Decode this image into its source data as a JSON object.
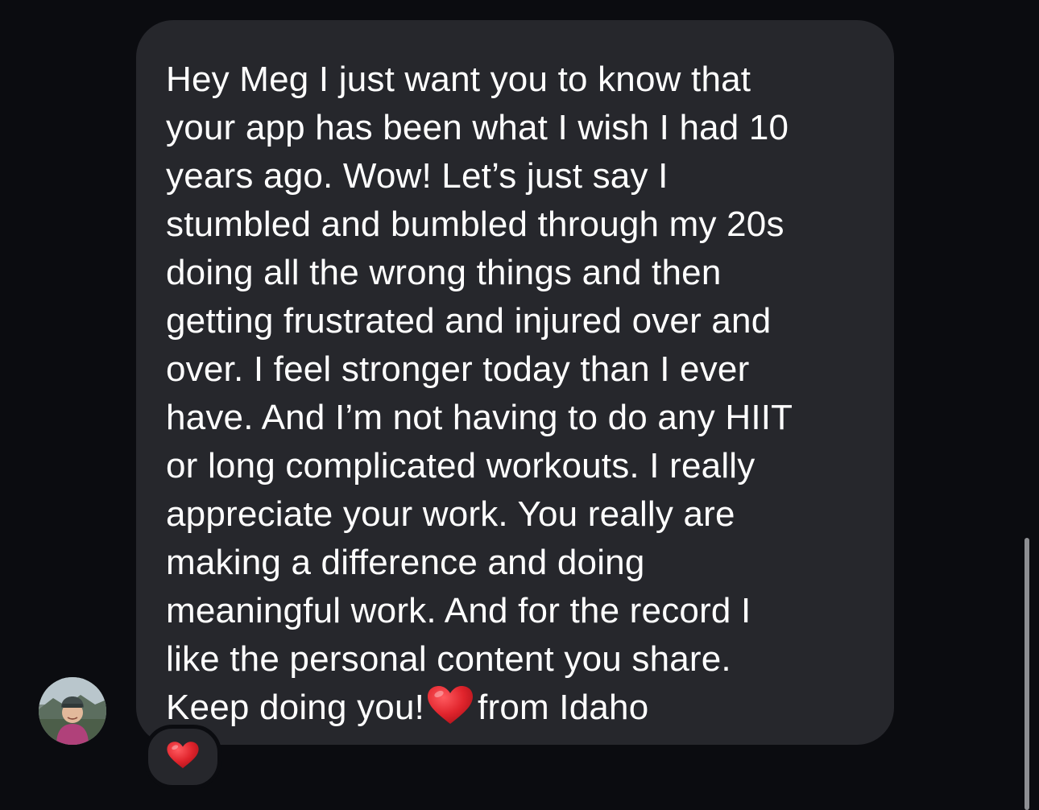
{
  "conversation": {
    "message": {
      "lines": [
        "Hey Meg I just want you to know that",
        "your app has been what I wish I had 10",
        "years ago. Wow! Let’s just say I",
        "stumbled and bumbled through my 20s",
        "doing all the wrong things and then",
        "getting frustrated and injured over and",
        "over. I feel stronger today than I ever",
        "have. And I’m not having to do any HIIT",
        "or long complicated workouts. I really",
        "appreciate your work. You really are",
        "making a difference and doing",
        "meaningful work. And for the record I",
        "like the personal content you share."
      ],
      "last_line_before_emoji": "Keep doing you!",
      "last_line_emoji": "red-heart-icon",
      "last_line_after_emoji": "from Idaho"
    },
    "reaction": {
      "emoji": "red-heart-icon"
    },
    "sender_avatar": "avatar"
  },
  "colors": {
    "background": "#0b0c10",
    "bubble": "#26272c",
    "text": "#ffffff",
    "heart": "#e0242c",
    "scrollbar": "#8e8f93"
  }
}
